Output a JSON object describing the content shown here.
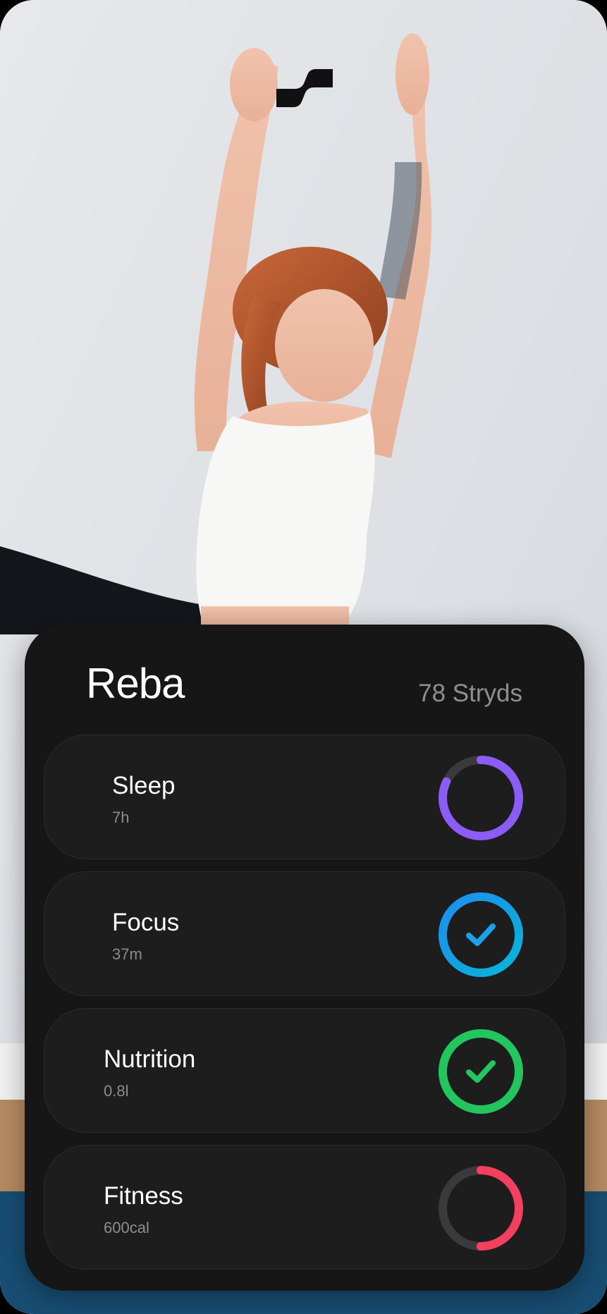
{
  "profile": {
    "name": "Reba",
    "points": "78 Stryds"
  },
  "metrics": [
    {
      "label": "Sleep",
      "value": "7h",
      "progress": 0.82,
      "completed": false,
      "color": "#8b5cf6",
      "icon": "progress-ring"
    },
    {
      "label": "Focus",
      "value": "37m",
      "progress": 1.0,
      "completed": true,
      "color": "#1ea0e8",
      "icon": "checkmark-icon"
    },
    {
      "label": "Nutrition",
      "value": "0.8l",
      "progress": 1.0,
      "completed": true,
      "color": "#22c55e",
      "icon": "checkmark-icon"
    },
    {
      "label": "Fitness",
      "value": "600cal",
      "progress": 0.5,
      "completed": false,
      "color": "#f43f5e",
      "icon": "progress-ring"
    }
  ],
  "colors": {
    "card_bg": "#161616",
    "row_bg": "#1d1d1e",
    "ring_track": "#3a3a3c"
  }
}
